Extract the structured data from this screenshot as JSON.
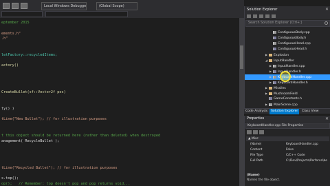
{
  "toolbar": {
    "config_combo": "Local Windows Debugger",
    "scope_combo": "(Global Scope)"
  },
  "nav": {
    "left_combo": "",
    "right_combo": ""
  },
  "editor": {
    "lines": [
      {
        "text": "eptember 2015",
        "cls": "c-com"
      },
      {
        "text": "",
        "cls": ""
      },
      {
        "text": "ements.h\"",
        "cls": "c-inc"
      },
      {
        "text": ".h\"",
        "cls": "c-inc"
      },
      {
        "text": "",
        "cls": ""
      },
      {
        "text": "",
        "cls": ""
      },
      {
        "text": "letFactory::recycledItems;",
        "cls": "c-cls"
      },
      {
        "text": "",
        "cls": ""
      },
      {
        "text": "actory()",
        "cls": "c-fn"
      },
      {
        "text": "",
        "cls": ""
      },
      {
        "text": "",
        "cls": ""
      },
      {
        "text": "",
        "cls": ""
      },
      {
        "text": "",
        "cls": ""
      },
      {
        "text": "CreateBullet(sf::Vector2f pos)",
        "cls": "c-fn"
      },
      {
        "text": "",
        "cls": ""
      },
      {
        "text": "",
        "cls": ""
      },
      {
        "text": "ty() )",
        "cls": ""
      },
      {
        "text": "",
        "cls": ""
      },
      {
        "text": "tLine(\"New Bullet\"); // for illustration purposes",
        "cls": "c-str"
      },
      {
        "text": "",
        "cls": ""
      },
      {
        "text": "",
        "cls": ""
      },
      {
        "text": "t this object should be returned here (rather than deleted) when destroyed",
        "cls": "c-com"
      },
      {
        "text": "anagement( RecycleBullet );",
        "cls": ""
      },
      {
        "text": "",
        "cls": ""
      },
      {
        "text": "",
        "cls": ""
      },
      {
        "text": "",
        "cls": ""
      },
      {
        "text": "",
        "cls": ""
      },
      {
        "text": "tLine(\"Recycled Bullet\"); // for illustration purposes",
        "cls": "c-str"
      },
      {
        "text": "",
        "cls": ""
      },
      {
        "text": "s.top();",
        "cls": ""
      },
      {
        "text": "op();   // Remember: top doesn't pop and pop returns void...",
        "cls": "c-com"
      }
    ]
  },
  "solution_explorer": {
    "title": "Solution Explorer",
    "search_placeholder": "Search Solution Explorer (Ctrl+;)",
    "items": [
      {
        "label": "ContiguousBody.cpp",
        "icon": "cpp",
        "indent": 3,
        "arrow": "",
        "selected": false
      },
      {
        "label": "ContiguousBody.h",
        "icon": "h",
        "indent": 3,
        "arrow": "",
        "selected": false
      },
      {
        "label": "ContiguousHead.cpp",
        "icon": "cpp",
        "indent": 3,
        "arrow": "",
        "selected": false
      },
      {
        "label": "ContiguousHead.h",
        "icon": "h",
        "indent": 3,
        "arrow": "",
        "selected": false
      },
      {
        "label": "Explosion",
        "icon": "folder",
        "indent": 2,
        "arrow": "▶",
        "selected": false
      },
      {
        "label": "InputHandler",
        "icon": "folder",
        "indent": 2,
        "arrow": "◢",
        "selected": false
      },
      {
        "label": "InputHandler.cpp",
        "icon": "cpp",
        "indent": 3,
        "arrow": "▶",
        "selected": false
      },
      {
        "label": "InputHandler.h",
        "icon": "h",
        "indent": 3,
        "arrow": "▶",
        "selected": false
      },
      {
        "label": "KeyboardHandler.cpp",
        "icon": "cpp",
        "indent": 3,
        "arrow": "▶",
        "selected": true
      },
      {
        "label": "KeyboardHandler.h",
        "icon": "h",
        "indent": 3,
        "arrow": "▶",
        "selected": false
      },
      {
        "label": "Missiles",
        "icon": "folder",
        "indent": 2,
        "arrow": "▶",
        "selected": false
      },
      {
        "label": "MushroomField",
        "icon": "folder",
        "indent": 2,
        "arrow": "▶",
        "selected": false
      },
      {
        "label": "GameConstants.h",
        "icon": "h",
        "indent": 2,
        "arrow": "",
        "selected": false
      },
      {
        "label": "MainScene.cpp",
        "icon": "cpp",
        "indent": 2,
        "arrow": "▶",
        "selected": false
      }
    ],
    "tabs": [
      "Code Analysis",
      "Solution Explorer",
      "Class View"
    ],
    "active_tab": 1
  },
  "properties": {
    "title": "Properties",
    "selected_object": "KeyboardHandler.cpp  File Properties",
    "category": "Misc",
    "rows": [
      {
        "name": "(Name)",
        "value": "KeyboardHandler.cpp"
      },
      {
        "name": "Content",
        "value": "False"
      },
      {
        "name": "File Type",
        "value": "C/C++ Code"
      },
      {
        "name": "Full Path",
        "value": "C:\\Dev\\Projects\\Perforce\\be"
      }
    ],
    "desc_name": "(Name)",
    "desc_text": "Names the file object."
  },
  "colors": {
    "accent": "#007acc",
    "selection": "#3399ff",
    "editor_bg": "#1e1e1e",
    "panel_bg": "#252526",
    "cursor_highlight": "#f2e23a"
  }
}
